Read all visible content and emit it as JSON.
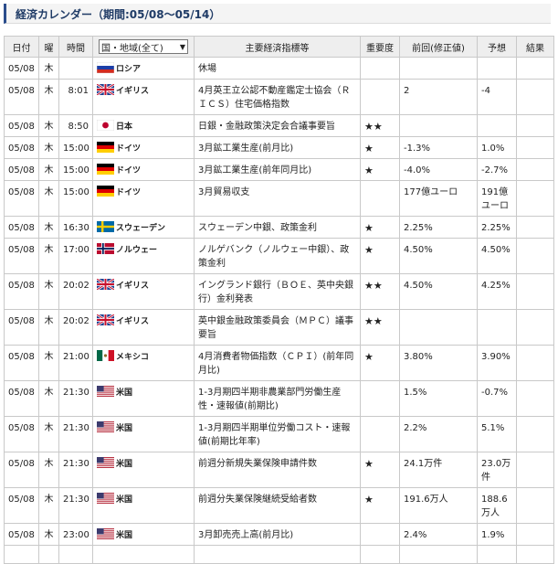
{
  "page": {
    "title": "経済カレンダー（期間:05/08～05/14）"
  },
  "table": {
    "headers": {
      "date": "日付",
      "weekday": "曜",
      "time": "時間",
      "region_select": "国・地域(全て)",
      "indicator": "主要経済指標等",
      "importance": "重要度",
      "previous": "前回(修正値)",
      "forecast": "予想",
      "result": "結果"
    },
    "rows": [
      {
        "date": "05/08",
        "day": "木",
        "time": "",
        "flag": "ru",
        "country": "ロシア",
        "indicator": "休場",
        "importance": "",
        "previous": "",
        "forecast": "",
        "result": ""
      },
      {
        "date": "05/08",
        "day": "木",
        "time": "8:01",
        "flag": "uk",
        "country": "イギリス",
        "indicator": "4月英王立公認不動産鑑定士協会（ＲＩＣＳ）住宅価格指数",
        "importance": "",
        "previous": "2",
        "forecast": "-4",
        "result": ""
      },
      {
        "date": "05/08",
        "day": "木",
        "time": "8:50",
        "flag": "jp",
        "country": "日本",
        "indicator": "日銀・金融政策決定会合議事要旨",
        "importance": "★★",
        "previous": "",
        "forecast": "",
        "result": ""
      },
      {
        "date": "05/08",
        "day": "木",
        "time": "15:00",
        "flag": "de",
        "country": "ドイツ",
        "indicator": "3月鉱工業生産(前月比)",
        "importance": "★",
        "previous": "-1.3%",
        "forecast": "1.0%",
        "result": ""
      },
      {
        "date": "05/08",
        "day": "木",
        "time": "15:00",
        "flag": "de",
        "country": "ドイツ",
        "indicator": "3月鉱工業生産(前年同月比)",
        "importance": "★",
        "previous": "-4.0%",
        "forecast": "-2.7%",
        "result": ""
      },
      {
        "date": "05/08",
        "day": "木",
        "time": "15:00",
        "flag": "de",
        "country": "ドイツ",
        "indicator": "3月貿易収支",
        "importance": "",
        "previous": "177億ユーロ",
        "forecast": "191億ユーロ",
        "result": ""
      },
      {
        "date": "05/08",
        "day": "木",
        "time": "16:30",
        "flag": "se",
        "country": "スウェーデン",
        "indicator": "スウェーデン中銀、政策金利",
        "importance": "★",
        "previous": "2.25%",
        "forecast": "2.25%",
        "result": ""
      },
      {
        "date": "05/08",
        "day": "木",
        "time": "17:00",
        "flag": "no",
        "country": "ノルウェー",
        "indicator": "ノルゲバンク（ノルウェー中銀）、政策金利",
        "importance": "★",
        "previous": "4.50%",
        "forecast": "4.50%",
        "result": ""
      },
      {
        "date": "05/08",
        "day": "木",
        "time": "20:02",
        "flag": "uk",
        "country": "イギリス",
        "indicator": "イングランド銀行（ＢＯＥ、英中央銀行）金利発表",
        "importance": "★★",
        "previous": "4.50%",
        "forecast": "4.25%",
        "result": ""
      },
      {
        "date": "05/08",
        "day": "木",
        "time": "20:02",
        "flag": "uk",
        "country": "イギリス",
        "indicator": "英中銀金融政策委員会（ＭＰＣ）議事要旨",
        "importance": "★★",
        "previous": "",
        "forecast": "",
        "result": ""
      },
      {
        "date": "05/08",
        "day": "木",
        "time": "21:00",
        "flag": "mx",
        "country": "メキシコ",
        "indicator": "4月消費者物価指数（ＣＰＩ）(前年同月比)",
        "importance": "★",
        "previous": "3.80%",
        "forecast": "3.90%",
        "result": ""
      },
      {
        "date": "05/08",
        "day": "木",
        "time": "21:30",
        "flag": "us",
        "country": "米国",
        "indicator": "1-3月期四半期非農業部門労働生産性・速報値(前期比)",
        "importance": "",
        "previous": "1.5%",
        "forecast": "-0.7%",
        "result": ""
      },
      {
        "date": "05/08",
        "day": "木",
        "time": "21:30",
        "flag": "us",
        "country": "米国",
        "indicator": "1-3月期四半期単位労働コスト・速報値(前期比年率)",
        "importance": "",
        "previous": "2.2%",
        "forecast": "5.1%",
        "result": ""
      },
      {
        "date": "05/08",
        "day": "木",
        "time": "21:30",
        "flag": "us",
        "country": "米国",
        "indicator": "前週分新規失業保険申請件数",
        "importance": "★",
        "previous": "24.1万件",
        "forecast": "23.0万件",
        "result": ""
      },
      {
        "date": "05/08",
        "day": "木",
        "time": "21:30",
        "flag": "us",
        "country": "米国",
        "indicator": "前週分失業保険継続受給者数",
        "importance": "★",
        "previous": "191.6万人",
        "forecast": "188.6万人",
        "result": ""
      },
      {
        "date": "05/08",
        "day": "木",
        "time": "23:00",
        "flag": "us",
        "country": "米国",
        "indicator": "3月卸売売上高(前月比)",
        "importance": "",
        "previous": "2.4%",
        "forecast": "1.9%",
        "result": ""
      },
      {
        "date": "",
        "day": "",
        "time": "",
        "flag": "",
        "country": "",
        "indicator": "",
        "importance": "",
        "previous": "",
        "forecast": "",
        "result": ""
      }
    ]
  }
}
